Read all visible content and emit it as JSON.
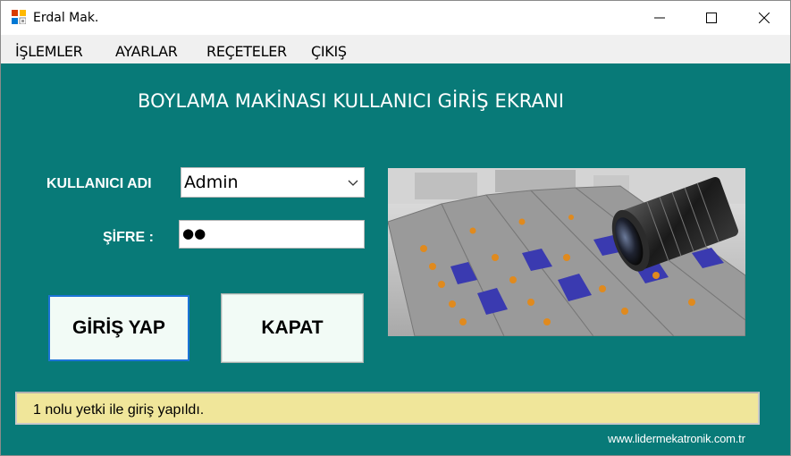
{
  "window": {
    "title": "Erdal Mak.",
    "icons": {
      "app": "app-icon",
      "minimize": "minimize-icon",
      "maximize": "maximize-icon",
      "close": "close-icon"
    }
  },
  "menu": {
    "items": [
      "İŞLEMLER",
      "AYARLAR",
      "REÇETELER",
      "ÇIKIŞ"
    ]
  },
  "header": {
    "title": "BOYLAMA MAKİNASI  KULLANICI GİRİŞ EKRANI"
  },
  "form": {
    "username_label": "KULLANICI ADI",
    "username_value": "Admin",
    "password_label": "ŞİFRE  :",
    "password_value": "●●",
    "login_button": "GİRİŞ YAP",
    "close_button": "KAPAT"
  },
  "status": {
    "message": "1 nolu yetki ile giriş yapıldı."
  },
  "footer": {
    "website": "www.lidermekatronik.com.tr"
  },
  "colors": {
    "background": "#087a78",
    "status_bar": "#f0e69a",
    "button_bg": "#f2fbf6",
    "focus_border": "#1c74d6"
  }
}
